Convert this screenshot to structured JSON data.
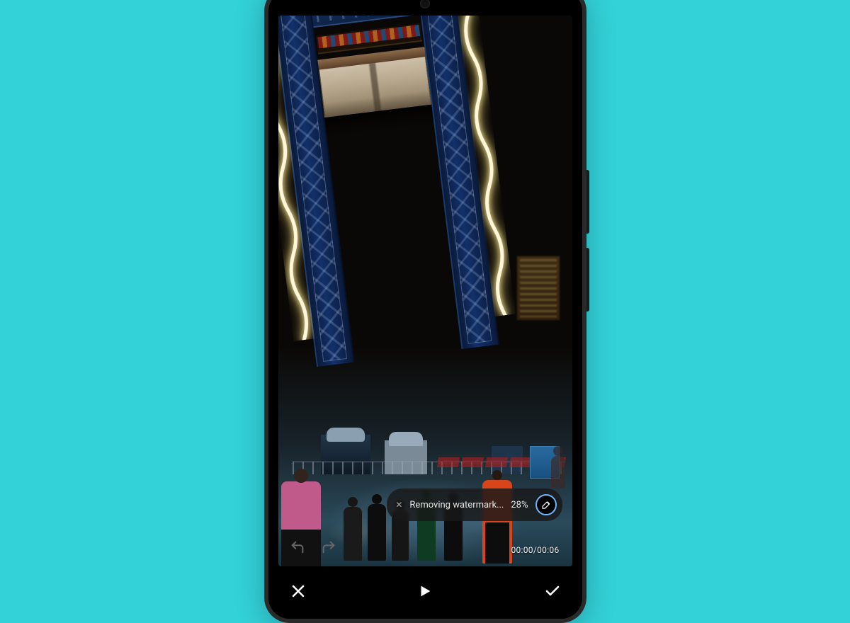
{
  "toast": {
    "message": "Removing watermark...",
    "progress": "28%"
  },
  "playback": {
    "current": "00:00",
    "total": "00:06"
  },
  "icons": {
    "close": "close",
    "play": "play",
    "confirm": "check",
    "undo": "undo",
    "redo": "redo",
    "eraser": "eraser"
  }
}
